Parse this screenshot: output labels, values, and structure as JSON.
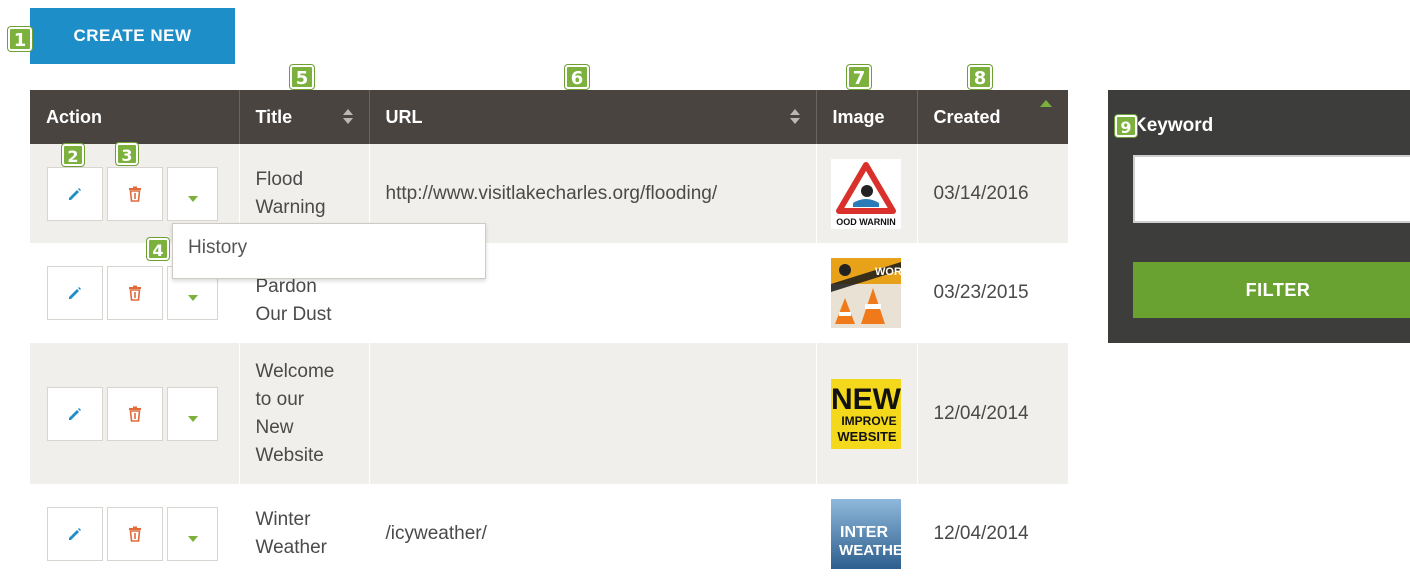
{
  "toolbar": {
    "create_label": "CREATE NEW"
  },
  "table": {
    "columns": {
      "action": "Action",
      "title": "Title",
      "url": "URL",
      "image": "Image",
      "created": "Created"
    },
    "rows": [
      {
        "title_lines": [
          "Flood",
          "Warning"
        ],
        "url": "http://www.visitlakecharles.org/flooding/",
        "date": "03/14/2016",
        "image": "flood-warning-thumbnail"
      },
      {
        "title_lines": [
          "Pardon",
          "Our Dust"
        ],
        "url": "",
        "date": "03/23/2015",
        "image": "work-construction-thumbnail"
      },
      {
        "title_lines": [
          "Welcome",
          "to our",
          "New",
          "Website"
        ],
        "url": "",
        "date": "12/04/2014",
        "image": "new-website-thumbnail"
      },
      {
        "title_lines": [
          "Winter",
          "Weather"
        ],
        "url": "/icyweather/",
        "date": "12/04/2014",
        "image": "winter-weather-thumbnail"
      }
    ]
  },
  "dropdown": {
    "history_label": "History"
  },
  "filter": {
    "keyword_label": "Keyword",
    "keyword_value": "",
    "button_label": "FILTER"
  },
  "callouts": [
    "1",
    "2",
    "3",
    "4",
    "5",
    "6",
    "7",
    "8",
    "9"
  ],
  "thumb_text": {
    "flood": "OOD WARNIN",
    "work": "WORK",
    "new_1": "NEW",
    "new_2": "IMPROVE",
    "new_3": "WEBSITE",
    "winter_1": "INTER",
    "winter_2": "WEATHE"
  },
  "colors": {
    "accent_blue": "#1e8ec9",
    "accent_green": "#7bb13c",
    "header_bg": "#4a4440",
    "panel_bg": "#3d3d3b",
    "filter_green": "#6aa232",
    "delete_red": "#e06a3c",
    "edit_blue": "#1e8ec9"
  },
  "icons": {
    "edit": "pencil-icon",
    "delete": "trash-icon",
    "more": "caret-down-icon",
    "sort": "sort-icon",
    "sort_asc": "sort-ascending-icon"
  }
}
